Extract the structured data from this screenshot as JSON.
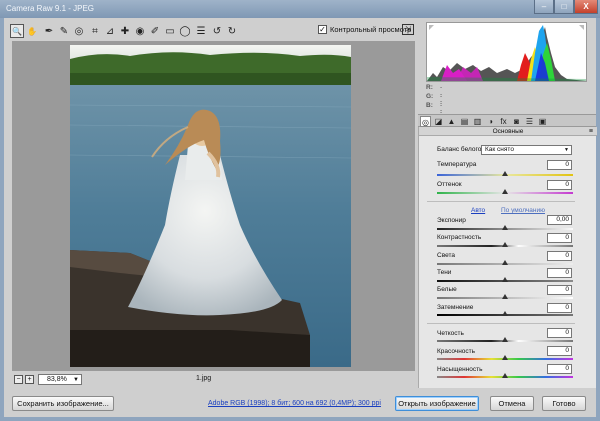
{
  "window": {
    "title": "Camera Raw 9.1  -  JPEG",
    "minimize": "–",
    "maximize": "□",
    "close": "X"
  },
  "toolbar": {
    "tools": [
      {
        "name": "zoom-tool",
        "glyph": "🔍"
      },
      {
        "name": "hand-tool",
        "glyph": "✋"
      },
      {
        "name": "white-balance-tool",
        "glyph": "✒"
      },
      {
        "name": "color-sampler-tool",
        "glyph": "✎"
      },
      {
        "name": "targeted-adjustment-tool",
        "glyph": "◎"
      },
      {
        "name": "crop-tool",
        "glyph": "⌗"
      },
      {
        "name": "straighten-tool",
        "glyph": "⊿"
      },
      {
        "name": "spot-removal-tool",
        "glyph": "✚"
      },
      {
        "name": "red-eye-tool",
        "glyph": "◉"
      },
      {
        "name": "adjustment-brush-tool",
        "glyph": "✐"
      },
      {
        "name": "graduated-filter-tool",
        "glyph": "▭"
      },
      {
        "name": "radial-filter-tool",
        "glyph": "◯"
      },
      {
        "name": "preferences-tool",
        "glyph": "☰"
      },
      {
        "name": "rotate-ccw-tool",
        "glyph": "↺"
      },
      {
        "name": "rotate-cw-tool",
        "glyph": "↻"
      }
    ],
    "preview_label": "Контрольный просмотр",
    "preview_checked": "✓",
    "fullscreen_glyph": "⇲"
  },
  "canvas": {
    "zoom_value": "83,8%",
    "zoom_minus": "−",
    "zoom_plus": "+",
    "filename": "1.jpg"
  },
  "bottom": {
    "save_label": "Сохранить изображение...",
    "workflow_info": "Adobe RGB (1998); 8 бит; 600 на 692 (0,4МР); 300 ppi",
    "open_label": "Открыть изображение",
    "cancel_label": "Отмена",
    "done_label": "Готово"
  },
  "rgb_readout": {
    "r_label": "R:",
    "r_value": "---",
    "g_label": "G:",
    "g_value": "---",
    "b_label": "B:",
    "b_value": "---"
  },
  "panel": {
    "title": "Основные",
    "menu_glyph": "≡",
    "wb_label": "Баланс белого:",
    "wb_value": "Как снято",
    "auto_label": "Авто",
    "default_label": "По умолчанию",
    "sliders": [
      {
        "key": "temperature",
        "label": "Температура",
        "value": "0",
        "pos": 0.5
      },
      {
        "key": "tint",
        "label": "Оттенок",
        "value": "0",
        "pos": 0.5
      },
      {
        "key": "exposure",
        "label": "Экспонир",
        "value": "0,00",
        "pos": 0.5
      },
      {
        "key": "contrast",
        "label": "Контрастность",
        "value": "0",
        "pos": 0.5
      },
      {
        "key": "highlights",
        "label": "Света",
        "value": "0",
        "pos": 0.5
      },
      {
        "key": "shadows",
        "label": "Тени",
        "value": "0",
        "pos": 0.5
      },
      {
        "key": "whites",
        "label": "Белые",
        "value": "0",
        "pos": 0.5
      },
      {
        "key": "blacks",
        "label": "Затемнение",
        "value": "0",
        "pos": 0.5
      },
      {
        "key": "clarity",
        "label": "Четкость",
        "value": "0",
        "pos": 0.5
      },
      {
        "key": "vibrance",
        "label": "Красочность",
        "value": "0",
        "pos": 0.5
      },
      {
        "key": "saturation",
        "label": "Насыщенность",
        "value": "0",
        "pos": 0.5
      }
    ],
    "tabs": [
      "◎",
      "◪",
      "▲",
      "▤",
      "▥",
      "◑",
      "fx",
      "◙",
      "☰",
      "▣"
    ]
  },
  "colors": {
    "accent": "#3f8ed8",
    "link": "#1a3fc0"
  }
}
